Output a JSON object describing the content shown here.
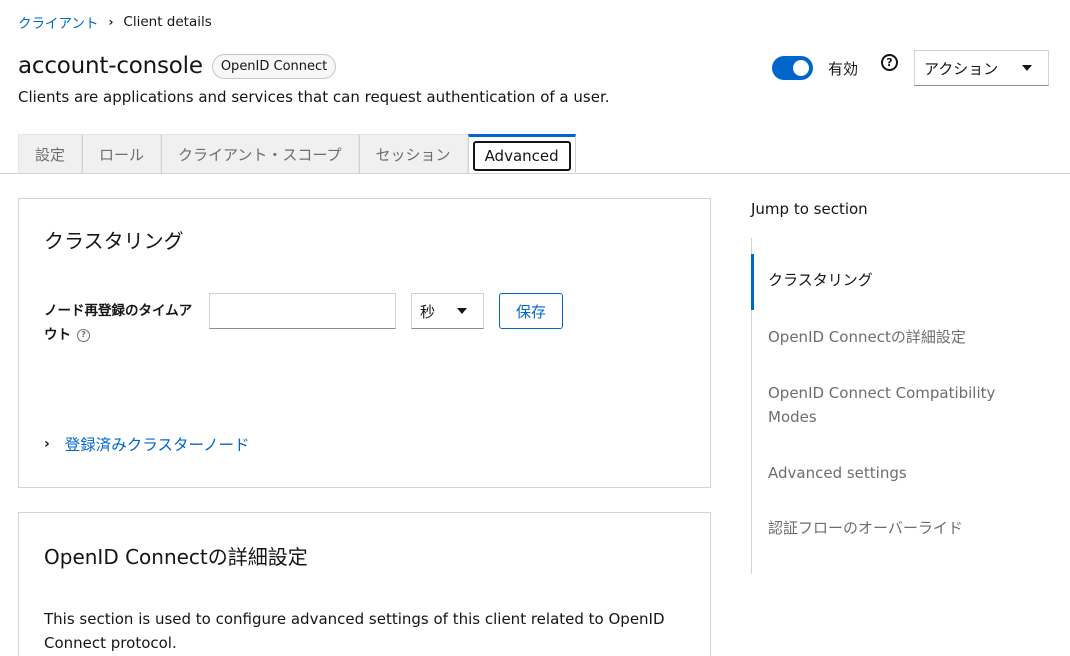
{
  "breadcrumb": {
    "parent": "クライアント",
    "current": "Client details"
  },
  "header": {
    "title": "account-console",
    "protocol_badge": "OpenID Connect",
    "description": "Clients are applications and services that can request authentication of a user.",
    "enabled_label": "有効",
    "enabled": true,
    "action_label": "アクション"
  },
  "tabs": [
    {
      "label": "設定"
    },
    {
      "label": "ロール"
    },
    {
      "label": "クライアント・スコープ"
    },
    {
      "label": "セッション"
    },
    {
      "label": "Advanced"
    }
  ],
  "active_tab": "Advanced",
  "clustering": {
    "title": "クラスタリング",
    "field_label": "ノード再登録のタイムアウト",
    "timeout_value": "",
    "unit_value": "秒",
    "save_label": "保存",
    "registered_nodes_label": "登録済みクラスターノード"
  },
  "oidc_section": {
    "title": "OpenID Connectの詳細設定",
    "description": "This section is used to configure advanced settings of this client related to OpenID Connect protocol."
  },
  "jump": {
    "title": "Jump to section",
    "items": [
      {
        "label": "クラスタリング"
      },
      {
        "label": "OpenID Connectの詳細設定"
      },
      {
        "label": "OpenID Connect Compatibility Modes"
      },
      {
        "label": "Advanced settings"
      },
      {
        "label": "認証フローのオーバーライド"
      }
    ]
  },
  "colors": {
    "accent": "#0066cc",
    "text": "#151515",
    "muted": "#6a6e73",
    "border": "#d2d2d2"
  }
}
